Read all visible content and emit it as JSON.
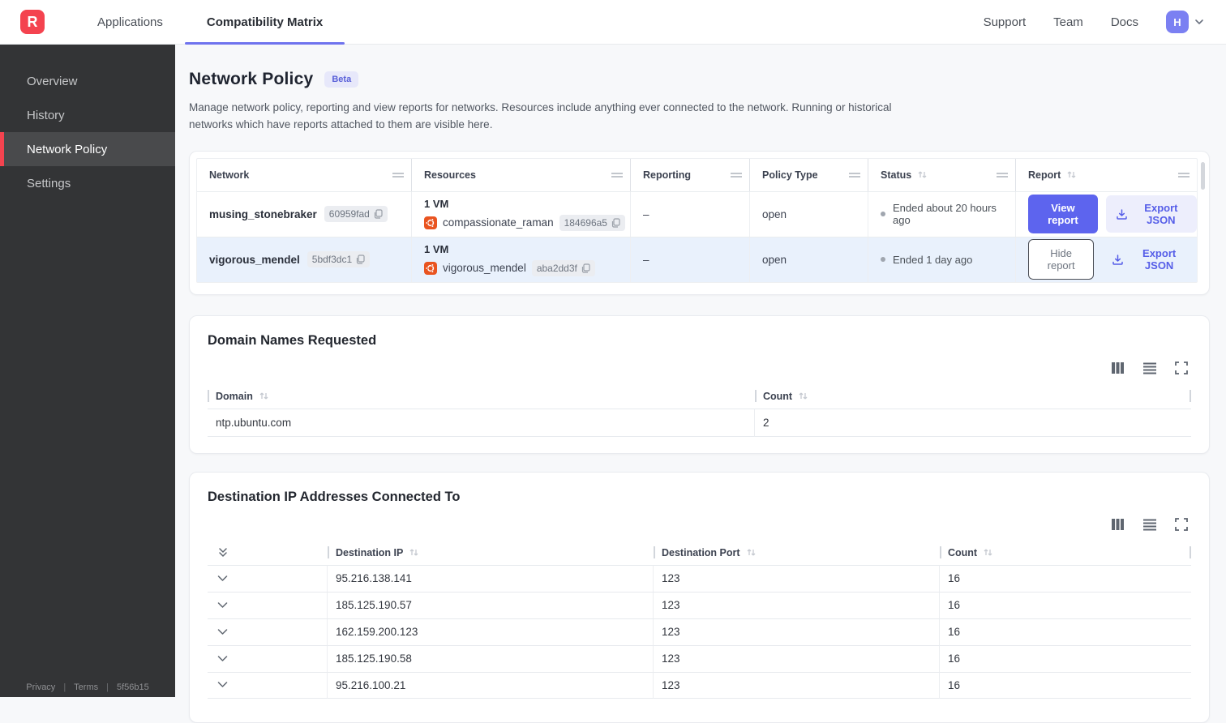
{
  "header": {
    "logo_letter": "R",
    "tabs": [
      {
        "label": "Applications"
      },
      {
        "label": "Compatibility Matrix"
      }
    ],
    "links": {
      "support": "Support",
      "team": "Team",
      "docs": "Docs"
    },
    "avatar_letter": "H"
  },
  "sidebar": {
    "items": [
      {
        "label": "Overview"
      },
      {
        "label": "History"
      },
      {
        "label": "Network Policy"
      },
      {
        "label": "Settings"
      }
    ],
    "footer": {
      "privacy": "Privacy",
      "terms": "Terms",
      "build": "5f56b15"
    }
  },
  "page": {
    "title": "Network Policy",
    "badge": "Beta",
    "description": "Manage network policy, reporting and view reports for networks. Resources include anything ever connected to the network. Running or historical networks which have reports attached to them are visible here."
  },
  "networks_table": {
    "columns": [
      "Network",
      "Resources",
      "Reporting",
      "Policy Type",
      "Status",
      "Report"
    ],
    "rows": [
      {
        "network_name": "musing_stonebraker",
        "network_hash": "60959fad",
        "resources_count": "1 VM",
        "resource_name": "compassionate_raman",
        "resource_hash": "184696a5",
        "reporting": "–",
        "policy_type": "open",
        "status": "Ended about 20 hours ago",
        "report_button": "View report",
        "export_button": "Export JSON"
      },
      {
        "network_name": "vigorous_mendel",
        "network_hash": "5bdf3dc1",
        "resources_count": "1 VM",
        "resource_name": "vigorous_mendel",
        "resource_hash": "aba2dd3f",
        "reporting": "–",
        "policy_type": "open",
        "status": "Ended 1 day ago",
        "report_button": "Hide report",
        "export_button": "Export JSON"
      }
    ]
  },
  "domains_section": {
    "title": "Domain Names Requested",
    "columns": {
      "domain": "Domain",
      "count": "Count"
    },
    "rows": [
      {
        "domain": "ntp.ubuntu.com",
        "count": "2"
      }
    ]
  },
  "destinations_section": {
    "title": "Destination IP Addresses Connected To",
    "columns": {
      "ip": "Destination IP",
      "port": "Destination Port",
      "count": "Count"
    },
    "rows": [
      {
        "ip": "95.216.138.141",
        "port": "123",
        "count": "16"
      },
      {
        "ip": "185.125.190.57",
        "port": "123",
        "count": "16"
      },
      {
        "ip": "162.159.200.123",
        "port": "123",
        "count": "16"
      },
      {
        "ip": "185.125.190.58",
        "port": "123",
        "count": "16"
      },
      {
        "ip": "95.216.100.21",
        "port": "123",
        "count": "16"
      }
    ]
  },
  "colors": {
    "brand_red": "#f4434f",
    "accent_indigo": "#5d64ee",
    "active_tab_underline": "#6f73ee",
    "row_highlight": "#e9f1fc",
    "sidebar_bg": "#333436",
    "ubuntu_orange": "#e95420"
  }
}
